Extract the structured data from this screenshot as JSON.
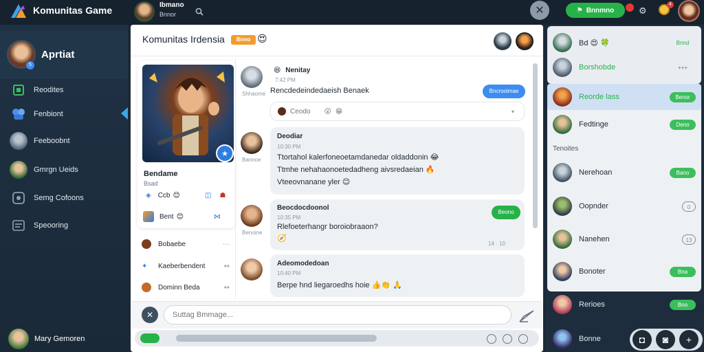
{
  "app": {
    "title": "Komunitas Game"
  },
  "topbar": {
    "user_name": "Ibmano",
    "user_sub": "Bnnor",
    "green_button": "Bnnmno",
    "coin_badge": "4"
  },
  "sidebar": {
    "profile_name": "Aprtiat",
    "profile_badge": "5",
    "items": [
      {
        "label": "Reodites"
      },
      {
        "label": "Fenbiont"
      },
      {
        "label": "Feeboobnt"
      },
      {
        "label": "Gmrgn Ueids"
      },
      {
        "label": "Semg Cofoons"
      },
      {
        "label": "Speooring"
      }
    ],
    "bottom_user": "Mary Gemoren"
  },
  "chat": {
    "title": "Komunitas Irdensia",
    "title_badge": "Bnno",
    "title_emoji": "😍"
  },
  "card": {
    "name": "Bendame",
    "sub": "Bsad",
    "row1_label": "Ccb",
    "row2_label": "Bent",
    "channels": [
      {
        "label": "Bobaebe"
      },
      {
        "label": "Kaeberbendent"
      },
      {
        "label": "Dominn Beda"
      }
    ]
  },
  "messages": [
    {
      "name": "Nenitay",
      "time": "7:42 PM",
      "text": "Rencdedeindedaeish Benaek",
      "author_short": "Shhaome",
      "pill": "Bncrooimae",
      "reactions_label": "Ceodo"
    },
    {
      "name": "Deodiar",
      "time": "10:30 PM",
      "author_short": "Bannoe",
      "lines": [
        "Ttortahol kalerfoneoetamdanedar oldaddonin 😂",
        "Ttmhe nehahaonoetedadheng aivsredaeian 🔥",
        "Vteeovnanane yler 😊"
      ]
    },
    {
      "name": "Beocdocdoonol",
      "time": "10:35 PM",
      "author_short": "Benoine",
      "pill": "Beono",
      "line": "Rlefoeterhangr boroiobraaon?",
      "footer": "14 · 10"
    },
    {
      "name": "Adeomodedoan",
      "time": "10:40 PM",
      "line": "Berpe hnd liegaroedhs hoie 👍👏 🙏"
    }
  ],
  "input": {
    "placeholder": "Suttag Bmmage..."
  },
  "right_panel": {
    "section_label": "Tenoites",
    "rows": [
      {
        "name": "Bd 😍 🍀",
        "pill": "Bnnd"
      },
      {
        "name": "Borshobde",
        "pill": "+++"
      },
      {
        "name": "Reorde lass",
        "pill": "Benor"
      },
      {
        "name": "Fedtinge",
        "pill": "Deno"
      },
      {
        "name": "Nerehoan",
        "pill": "Bano"
      },
      {
        "name": "Oopnder",
        "pill": "0"
      },
      {
        "name": "Nanehen",
        "pill": "13"
      },
      {
        "name": "Bonoter",
        "pill": "Bna"
      },
      {
        "name": "Rerioes",
        "pill": "Bno"
      },
      {
        "name": "Bonne",
        "pill": ""
      }
    ]
  },
  "colors": {
    "accent_blue": "#3d8df0",
    "green": "#27b249",
    "sidebar_bg": "#1f3144",
    "badge_orange": "#f39c2e"
  }
}
